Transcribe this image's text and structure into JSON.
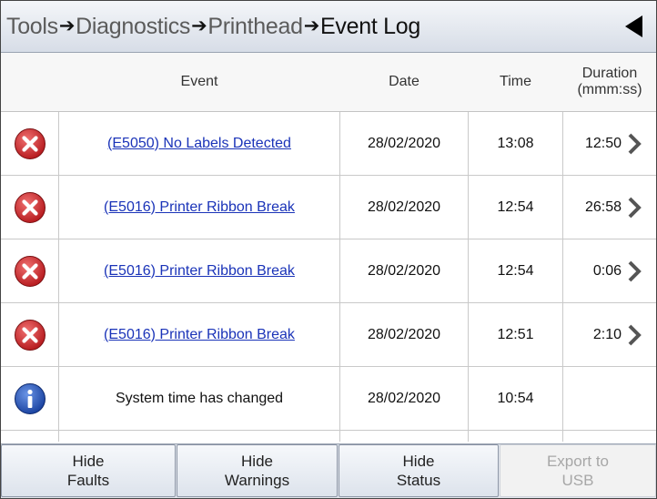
{
  "breadcrumb": {
    "items": [
      "Tools",
      "Diagnostics",
      "Printhead",
      "Event Log"
    ],
    "separator": "➔"
  },
  "table": {
    "headers": {
      "event": "Event",
      "date": "Date",
      "time": "Time",
      "duration_line1": "Duration",
      "duration_line2": "(mmm:ss)"
    },
    "rows": [
      {
        "icon": "error-icon",
        "event": "(E5050) No Labels Detected",
        "date": "28/02/2020",
        "time": "13:08",
        "duration": "12:50"
      },
      {
        "icon": "error-icon",
        "event": "(E5016) Printer Ribbon Break",
        "date": "28/02/2020",
        "time": "12:54",
        "duration": "26:58"
      },
      {
        "icon": "error-icon",
        "event": "(E5016) Printer Ribbon Break",
        "date": "28/02/2020",
        "time": "12:54",
        "duration": "0:06"
      },
      {
        "icon": "error-icon",
        "event": "(E5016) Printer Ribbon Break",
        "date": "28/02/2020",
        "time": "12:51",
        "duration": "2:10"
      },
      {
        "icon": "info-icon",
        "event": "System time has changed",
        "date": "28/02/2020",
        "time": "10:54",
        "duration": ""
      }
    ]
  },
  "footer": {
    "hide_faults": [
      "Hide",
      "Faults"
    ],
    "hide_warnings": [
      "Hide",
      "Warnings"
    ],
    "hide_status": [
      "Hide",
      "Status"
    ],
    "export_usb": [
      "Export to",
      "USB"
    ]
  },
  "colors": {
    "error": "#d8262a",
    "info": "#1e4fb8",
    "link": "#1a33b8",
    "disabled_text": "#a7a7a7"
  }
}
